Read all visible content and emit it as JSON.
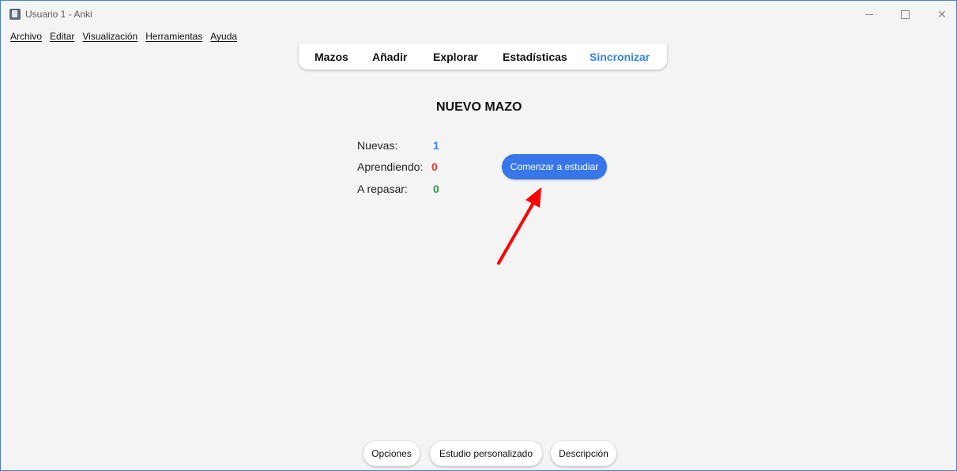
{
  "window": {
    "title": "Usuario 1 - Anki",
    "controls": {
      "minimize": "—",
      "close": "✕"
    }
  },
  "menu": [
    "Archivo",
    "Editar",
    "Visualización",
    "Herramientas",
    "Ayuda"
  ],
  "toolbar": {
    "items": [
      "Mazos",
      "Añadir",
      "Explorar",
      "Estadísticas",
      "Sincronizar"
    ],
    "active_color": "#3a82e8"
  },
  "deck": {
    "title": "NUEVO MAZO",
    "stats": [
      {
        "label": "Nuevas:",
        "value": "1",
        "color": "#3a82e8"
      },
      {
        "label": "Aprendiendo:",
        "value": "0",
        "color": "#e0302d"
      },
      {
        "label": "A repasar:",
        "value": "0",
        "color": "#2e9e45"
      }
    ],
    "study_button": "Comenzar a estudiar"
  },
  "annotation": {
    "arrow_color": "#ff0000"
  },
  "bottom_buttons": [
    "Opciones",
    "Estudio personalizado",
    "Descripción"
  ],
  "colors": {
    "primary_button": "#3976ea"
  }
}
